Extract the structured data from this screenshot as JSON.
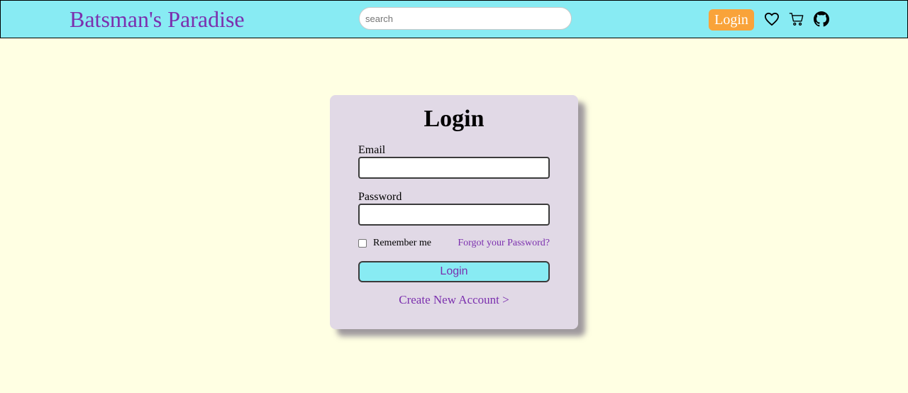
{
  "navbar": {
    "brand": "Batsman's Paradise",
    "search_placeholder": "search",
    "login_label": "Login",
    "icons": [
      "heart-icon",
      "cart-icon",
      "github-icon"
    ]
  },
  "login_form": {
    "title": "Login",
    "email_label": "Email",
    "email_value": "",
    "password_label": "Password",
    "password_value": "",
    "remember_label": "Remember me",
    "remember_checked": false,
    "forgot_label": "Forgot your Password?",
    "submit_label": "Login",
    "create_account_label": "Create New Account >"
  },
  "colors": {
    "page_background": "#ffffe3",
    "navbar_background": "#88ebf3",
    "brand": "#7b2fae",
    "login_button": "#f9a33a",
    "card_background": "#e1d9e6",
    "link": "#7b2fae"
  }
}
